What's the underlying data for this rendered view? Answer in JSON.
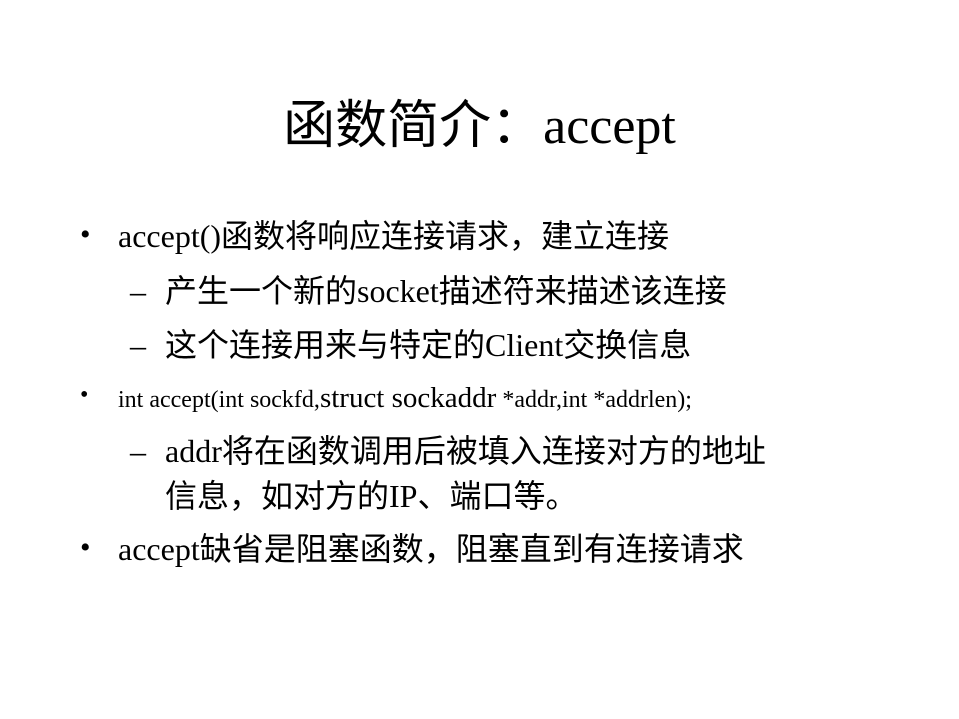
{
  "slide": {
    "title": "函数简介：accept",
    "bullet_glyph": "•",
    "dash_glyph": "–",
    "items": [
      {
        "level": 1,
        "text": "accept()函数将响应连接请求，建立连接"
      },
      {
        "level": 2,
        "text": "产生一个新的socket描述符来描述该连接"
      },
      {
        "level": 2,
        "text": "这个连接用来与特定的Client交换信息"
      },
      {
        "level": 1,
        "text_part1": "int accept(int sockfd,",
        "text_part2": "struct sockaddr",
        "text_part3": " *addr,int *addrlen);"
      },
      {
        "level": 2,
        "text_line1": "addr将在函数调用后被填入连接对方的地址",
        "text_line2": "信息，如对方的IP、端口等。"
      },
      {
        "level": 1,
        "text": "accept缺省是阻塞函数，阻塞直到有连接请求"
      }
    ]
  }
}
